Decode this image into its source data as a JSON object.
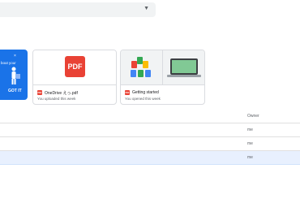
{
  "search": {
    "dropdown_icon": "arrow-drop-down-icon",
    "dropdown_glyph": "▼"
  },
  "promo": {
    "dismiss_glyph": "×",
    "text": "bout your",
    "button_label": "GOT IT",
    "accent": "#1a73e8"
  },
  "suggested": [
    {
      "name": "OneDrive えっ.pdf",
      "subtitle": "You uploaded this week",
      "type_icon": "pdf-icon",
      "thumb_label": "PDF"
    },
    {
      "name": "Getting started",
      "subtitle": "You opened this week",
      "type_icon": "pdf-icon"
    }
  ],
  "table": {
    "owner_header": "Owner",
    "rows": [
      {
        "owner": "me",
        "selected": false
      },
      {
        "owner": "me",
        "selected": false
      },
      {
        "owner": "me",
        "selected": true
      }
    ]
  },
  "colors": {
    "pdf_red": "#e94235",
    "selected_row": "#e8f0fe"
  }
}
